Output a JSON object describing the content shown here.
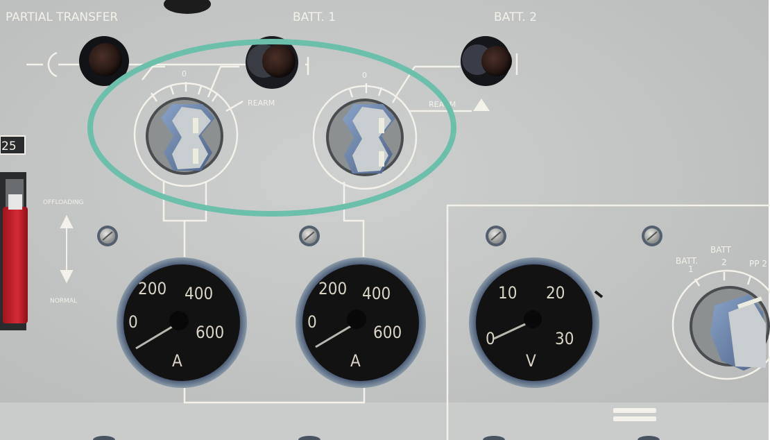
{
  "panel": {
    "labels": {
      "partial_transfer": "PARTIAL TRANSFER",
      "batt1": "BATT. 1",
      "batt2": "BATT. 2",
      "rearm1": "REARM",
      "rearm2": "REARM",
      "zero1": "0",
      "zero2": "0",
      "offloading": "OFFLOADING",
      "normal": "NORMAL",
      "left_edge_number": "25",
      "selector_batt1_a": "BATT.",
      "selector_batt1_b": "1",
      "selector_batt2_a": "BATT",
      "selector_batt2_b": "2",
      "selector_pp": "PP 2"
    },
    "ammeter1": {
      "t0": "0",
      "t200": "200",
      "t400": "400",
      "t600": "600",
      "unit": "A"
    },
    "ammeter2": {
      "t0": "0",
      "t200": "200",
      "t400": "400",
      "t600": "600",
      "unit": "A"
    },
    "voltmeter": {
      "t0": "0",
      "t10": "10",
      "t20": "20",
      "t30": "30",
      "unit": "V"
    }
  },
  "colors": {
    "panel": "#c4c7c6",
    "line": "#f3f1ea",
    "highlight": "#6cbfaa",
    "knob": "#7e93b4",
    "meter_face": "#121212",
    "red_guard": "#c21f2a"
  }
}
